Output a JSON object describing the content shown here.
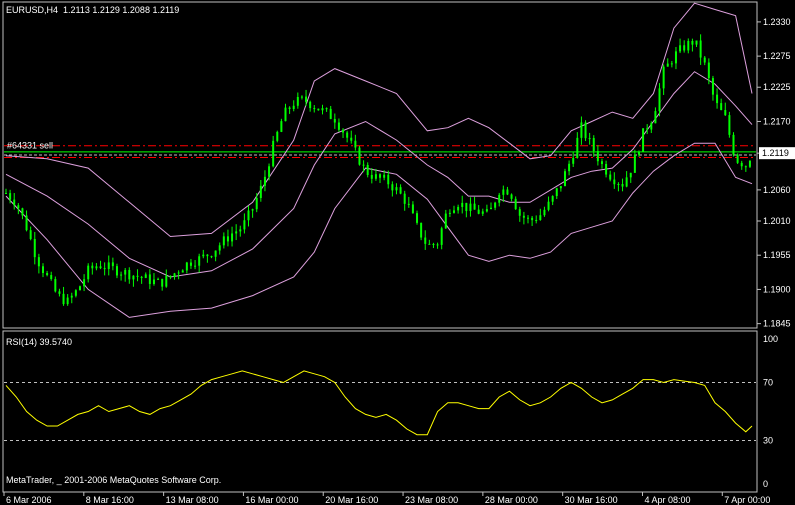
{
  "header": {
    "symbol": "EURUSD,H4",
    "ohlc": "1.2113 1.2129 1.2088 1.2119"
  },
  "order_label": "#64331 sell",
  "rsi_header": "RSI(14) 39.5740",
  "copyright": "MetaTrader, _ 2001-2006 MetaQuotes Software Corp.",
  "colors": {
    "background": "#000000",
    "candles": "#00ff00",
    "bands": "#dda0dd",
    "rsi_line": "#ffff00",
    "order_lines": "#ff0000",
    "level_lines": "#c0c0c0",
    "current_price_line": "#00ff00",
    "axis": "#c0c0c0"
  },
  "chart_data": [
    {
      "type": "line",
      "title": "EURUSD,H4",
      "y_ticks": [
        "1.2330",
        "1.2275",
        "1.2225",
        "1.2170",
        "1.2119",
        "1.2060",
        "1.2010",
        "1.1955",
        "1.1900",
        "1.1845"
      ],
      "y_tick_values": [
        1.233,
        1.2275,
        1.2225,
        1.217,
        1.2119,
        1.206,
        1.201,
        1.1955,
        1.19,
        1.1845
      ],
      "x_ticks": [
        "6 Mar 2006",
        "8 Mar 16:00",
        "13 Mar 08:00",
        "16 Mar 00:00",
        "20 Mar 16:00",
        "23 Mar 08:00",
        "28 Mar 00:00",
        "30 Mar 16:00",
        "4 Apr 08:00",
        "7 Apr 00:00"
      ],
      "current_price": "1.2119",
      "ylim": [
        1.1838,
        1.2362
      ],
      "order_lines": [
        1.2131,
        1.2112
      ],
      "series": [
        {
          "name": "",
          "close_path": [
            [
              0,
              1.2055
            ],
            [
              5,
              1.204
            ],
            [
              10,
              1.2
            ],
            [
              15,
              1.195
            ],
            [
              20,
              1.192
            ],
            [
              25,
              1.189
            ],
            [
              30,
              1.188
            ],
            [
              35,
              1.19
            ],
            [
              40,
              1.193
            ],
            [
              45,
              1.194
            ],
            [
              50,
              1.1935
            ],
            [
              55,
              1.193
            ],
            [
              60,
              1.1925
            ],
            [
              65,
              1.192
            ],
            [
              70,
              1.1915
            ],
            [
              75,
              1.191
            ],
            [
              80,
              1.192
            ],
            [
              85,
              1.1935
            ],
            [
              90,
              1.1945
            ],
            [
              95,
              1.195
            ],
            [
              100,
              1.196
            ],
            [
              105,
              1.1975
            ],
            [
              110,
              1.199
            ],
            [
              115,
              1.2
            ],
            [
              120,
              1.203
            ],
            [
              125,
              1.207
            ],
            [
              130,
              1.213
            ],
            [
              135,
              1.218
            ],
            [
              140,
              1.22
            ],
            [
              145,
              1.2205
            ],
            [
              150,
              1.2195
            ],
            [
              155,
              1.2185
            ],
            [
              160,
              1.2175
            ],
            [
              165,
              1.215
            ],
            [
              170,
              1.212
            ],
            [
              175,
              1.209
            ],
            [
              180,
              1.208
            ],
            [
              185,
              1.2075
            ],
            [
              190,
              1.206
            ],
            [
              195,
              1.204
            ],
            [
              200,
              1.2
            ],
            [
              205,
              1.197
            ],
            [
              210,
              1.1975
            ],
            [
              215,
              1.203
            ],
            [
              220,
              1.204
            ],
            [
              225,
              1.203
            ],
            [
              230,
              1.2025
            ],
            [
              235,
              1.202
            ],
            [
              240,
              1.206
            ],
            [
              245,
              1.206
            ],
            [
              250,
              1.202
            ],
            [
              255,
              1.201
            ],
            [
              260,
              1.202
            ],
            [
              265,
              1.204
            ],
            [
              270,
              1.207
            ],
            [
              275,
              1.211
            ],
            [
              280,
              1.216
            ],
            [
              285,
              1.213
            ],
            [
              290,
              1.21
            ],
            [
              295,
              1.208
            ],
            [
              300,
              1.207
            ],
            [
              305,
              1.21
            ],
            [
              310,
              1.215
            ],
            [
              315,
              1.218
            ],
            [
              320,
              1.225
            ],
            [
              325,
              1.2275
            ],
            [
              330,
              1.229
            ],
            [
              335,
              1.23
            ],
            [
              340,
              1.226
            ],
            [
              345,
              1.22
            ],
            [
              350,
              1.2175
            ],
            [
              355,
              1.211
            ],
            [
              360,
              1.21
            ],
            [
              363,
              1.2119
            ]
          ],
          "upper_band": [
            [
              0,
              1.2115
            ],
            [
              20,
              1.211
            ],
            [
              40,
              1.2095
            ],
            [
              60,
              1.204
            ],
            [
              80,
              1.1985
            ],
            [
              100,
              1.199
            ],
            [
              120,
              1.204
            ],
            [
              140,
              1.214
            ],
            [
              150,
              1.2235
            ],
            [
              160,
              1.2255
            ],
            [
              175,
              1.2235
            ],
            [
              190,
              1.2215
            ],
            [
              205,
              1.2155
            ],
            [
              215,
              1.216
            ],
            [
              225,
              1.2175
            ],
            [
              235,
              1.216
            ],
            [
              245,
              1.2135
            ],
            [
              255,
              1.211
            ],
            [
              265,
              1.2115
            ],
            [
              275,
              1.2155
            ],
            [
              285,
              1.217
            ],
            [
              295,
              1.2185
            ],
            [
              305,
              1.2175
            ],
            [
              315,
              1.2215
            ],
            [
              325,
              1.232
            ],
            [
              335,
              1.236
            ],
            [
              345,
              1.235
            ],
            [
              355,
              1.234
            ],
            [
              363,
              1.2215
            ]
          ],
          "middle_band": [
            [
              0,
              1.2085
            ],
            [
              20,
              1.205
            ],
            [
              40,
              1.2005
            ],
            [
              60,
              1.195
            ],
            [
              80,
              1.192
            ],
            [
              100,
              1.193
            ],
            [
              120,
              1.1965
            ],
            [
              140,
              1.203
            ],
            [
              150,
              1.21
            ],
            [
              160,
              1.215
            ],
            [
              175,
              1.217
            ],
            [
              190,
              1.214
            ],
            [
              205,
              1.21
            ],
            [
              215,
              1.208
            ],
            [
              225,
              1.205
            ],
            [
              235,
              1.205
            ],
            [
              245,
              1.204
            ],
            [
              255,
              1.204
            ],
            [
              265,
              1.206
            ],
            [
              275,
              1.208
            ],
            [
              285,
              1.209
            ],
            [
              295,
              1.2095
            ],
            [
              305,
              1.2125
            ],
            [
              315,
              1.217
            ],
            [
              325,
              1.2215
            ],
            [
              335,
              1.225
            ],
            [
              345,
              1.223
            ],
            [
              355,
              1.2195
            ],
            [
              363,
              1.2165
            ]
          ],
          "lower_band": [
            [
              0,
              1.205
            ],
            [
              20,
              1.198
            ],
            [
              40,
              1.19
            ],
            [
              60,
              1.1855
            ],
            [
              80,
              1.1865
            ],
            [
              100,
              1.187
            ],
            [
              120,
              1.189
            ],
            [
              140,
              1.192
            ],
            [
              150,
              1.196
            ],
            [
              160,
              1.203
            ],
            [
              175,
              1.2095
            ],
            [
              190,
              1.2085
            ],
            [
              205,
              1.2045
            ],
            [
              215,
              1.2
            ],
            [
              225,
              1.1955
            ],
            [
              235,
              1.1945
            ],
            [
              245,
              1.1955
            ],
            [
              255,
              1.195
            ],
            [
              265,
              1.196
            ],
            [
              275,
              1.199
            ],
            [
              285,
              1.2
            ],
            [
              295,
              1.201
            ],
            [
              305,
              1.2055
            ],
            [
              315,
              1.209
            ],
            [
              325,
              1.2115
            ],
            [
              335,
              1.2135
            ],
            [
              345,
              1.2135
            ],
            [
              355,
              1.208
            ],
            [
              363,
              1.207
            ]
          ]
        }
      ]
    },
    {
      "type": "line",
      "title": "RSI(14) 39.5740",
      "y_ticks": [
        "100",
        "70",
        "30",
        "0"
      ],
      "ylim": [
        0,
        100
      ],
      "levels": [
        70,
        30
      ],
      "series": [
        {
          "name": "",
          "points": [
            [
              0,
              68
            ],
            [
              5,
              60
            ],
            [
              10,
              50
            ],
            [
              15,
              44
            ],
            [
              20,
              40
            ],
            [
              25,
              40
            ],
            [
              30,
              44
            ],
            [
              35,
              48
            ],
            [
              40,
              50
            ],
            [
              45,
              54
            ],
            [
              50,
              50
            ],
            [
              55,
              52
            ],
            [
              60,
              54
            ],
            [
              65,
              50
            ],
            [
              70,
              48
            ],
            [
              75,
              52
            ],
            [
              80,
              54
            ],
            [
              85,
              58
            ],
            [
              90,
              62
            ],
            [
              95,
              68
            ],
            [
              100,
              72
            ],
            [
              105,
              74
            ],
            [
              110,
              76
            ],
            [
              115,
              78
            ],
            [
              120,
              76
            ],
            [
              125,
              74
            ],
            [
              130,
              72
            ],
            [
              135,
              70
            ],
            [
              140,
              74
            ],
            [
              145,
              78
            ],
            [
              150,
              76
            ],
            [
              155,
              74
            ],
            [
              160,
              70
            ],
            [
              165,
              60
            ],
            [
              170,
              52
            ],
            [
              175,
              48
            ],
            [
              180,
              46
            ],
            [
              185,
              48
            ],
            [
              190,
              44
            ],
            [
              195,
              38
            ],
            [
              200,
              34
            ],
            [
              205,
              34
            ],
            [
              210,
              50
            ],
            [
              215,
              56
            ],
            [
              220,
              56
            ],
            [
              225,
              54
            ],
            [
              230,
              52
            ],
            [
              235,
              52
            ],
            [
              240,
              60
            ],
            [
              245,
              64
            ],
            [
              250,
              58
            ],
            [
              255,
              54
            ],
            [
              260,
              56
            ],
            [
              265,
              60
            ],
            [
              270,
              66
            ],
            [
              275,
              70
            ],
            [
              280,
              66
            ],
            [
              285,
              60
            ],
            [
              290,
              56
            ],
            [
              295,
              58
            ],
            [
              300,
              62
            ],
            [
              305,
              66
            ],
            [
              310,
              72
            ],
            [
              315,
              72
            ],
            [
              320,
              70
            ],
            [
              325,
              72
            ],
            [
              330,
              71
            ],
            [
              335,
              70
            ],
            [
              340,
              68
            ],
            [
              345,
              56
            ],
            [
              350,
              50
            ],
            [
              355,
              42
            ],
            [
              360,
              36
            ],
            [
              363,
              40
            ]
          ]
        }
      ]
    }
  ]
}
